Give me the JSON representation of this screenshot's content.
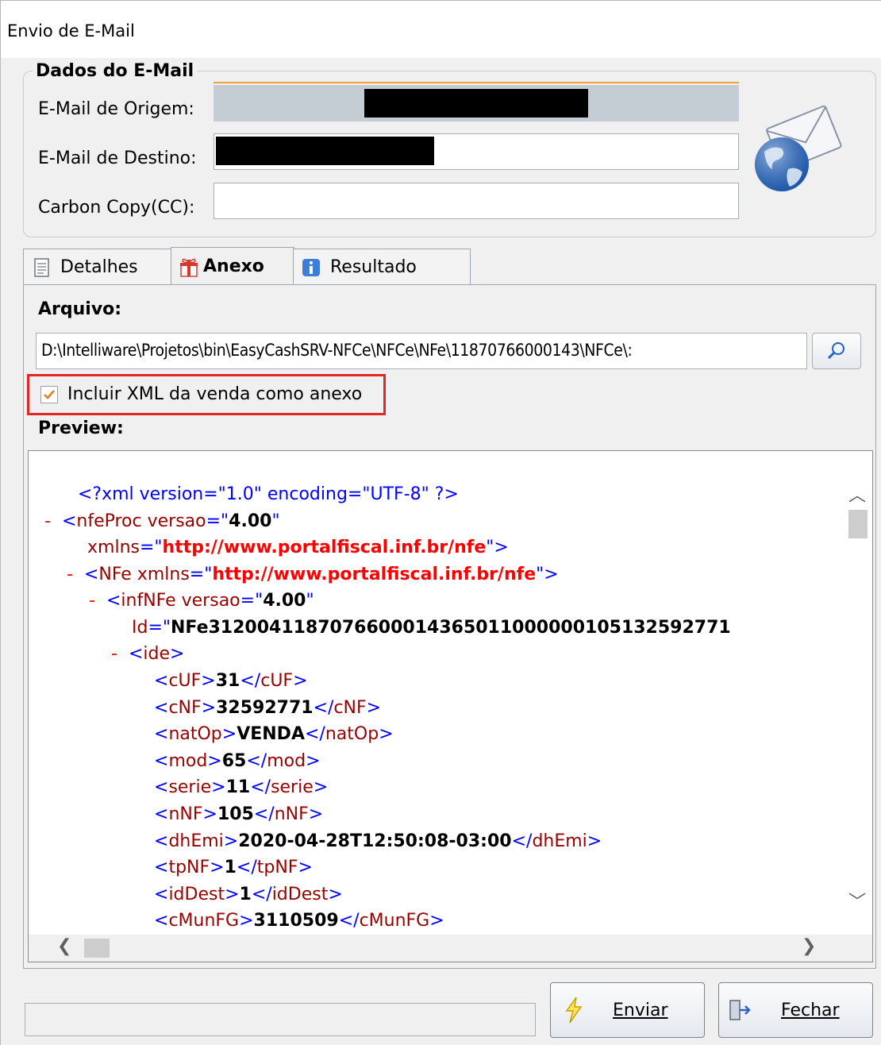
{
  "window": {
    "title": "Envio de E-Mail"
  },
  "email_group": {
    "legend": "Dados do E-Mail",
    "origin_label": "E-Mail de Origem:",
    "destination_label": "E-Mail de Destino:",
    "cc_label": "Carbon Copy(CC):",
    "cc_value": ""
  },
  "tabs": [
    {
      "label": "Detalhes",
      "icon": "document-icon"
    },
    {
      "label": "Anexo",
      "icon": "gift-icon",
      "active": true
    },
    {
      "label": "Resultado",
      "icon": "info-icon"
    }
  ],
  "anexo": {
    "arquivo_label": "Arquivo:",
    "file_path": "D:\\Intelliware\\Projetos\\bin\\EasyCashSRV-NFCe\\NFCe\\NFe\\11870766000143\\NFCe\\:",
    "include_xml_label": "Incluir XML da venda como anexo",
    "include_xml_checked": true,
    "preview_label": "Preview:"
  },
  "xml_preview": {
    "decl": "<?xml version=\"1.0\" encoding=\"UTF-8\" ?>",
    "minus": "-",
    "nfeProc_open": "<nfeProc versao=\"",
    "nfeProc_versao": "4.00",
    "quote": "\"",
    "xmlns_attr": "xmlns=\"",
    "xmlns_url": "http://www.portalfiscal.inf.br/nfe",
    "close_quote_gt": "\">",
    "nfe_open": "<NFe xmlns=\"",
    "infnfe_open": "<infNFe versao=\"",
    "infnfe_versao": "4.00",
    "id_attr": "Id=\"",
    "id_value": "NFe3120041187076600014365011000000105132592771",
    "ide_open": "<ide>",
    "fields": [
      {
        "tag": "cUF",
        "value": "31"
      },
      {
        "tag": "cNF",
        "value": "32592771"
      },
      {
        "tag": "natOp",
        "value": "VENDA"
      },
      {
        "tag": "mod",
        "value": "65"
      },
      {
        "tag": "serie",
        "value": "11"
      },
      {
        "tag": "nNF",
        "value": "105"
      },
      {
        "tag": "dhEmi",
        "value": "2020-04-28T12:50:08-03:00"
      },
      {
        "tag": "tpNF",
        "value": "1"
      },
      {
        "tag": "idDest",
        "value": "1"
      },
      {
        "tag": "cMunFG",
        "value": "3110509"
      }
    ]
  },
  "buttons": {
    "send_label": "Enviar",
    "close_label": "Fechar"
  },
  "status_text": ""
}
